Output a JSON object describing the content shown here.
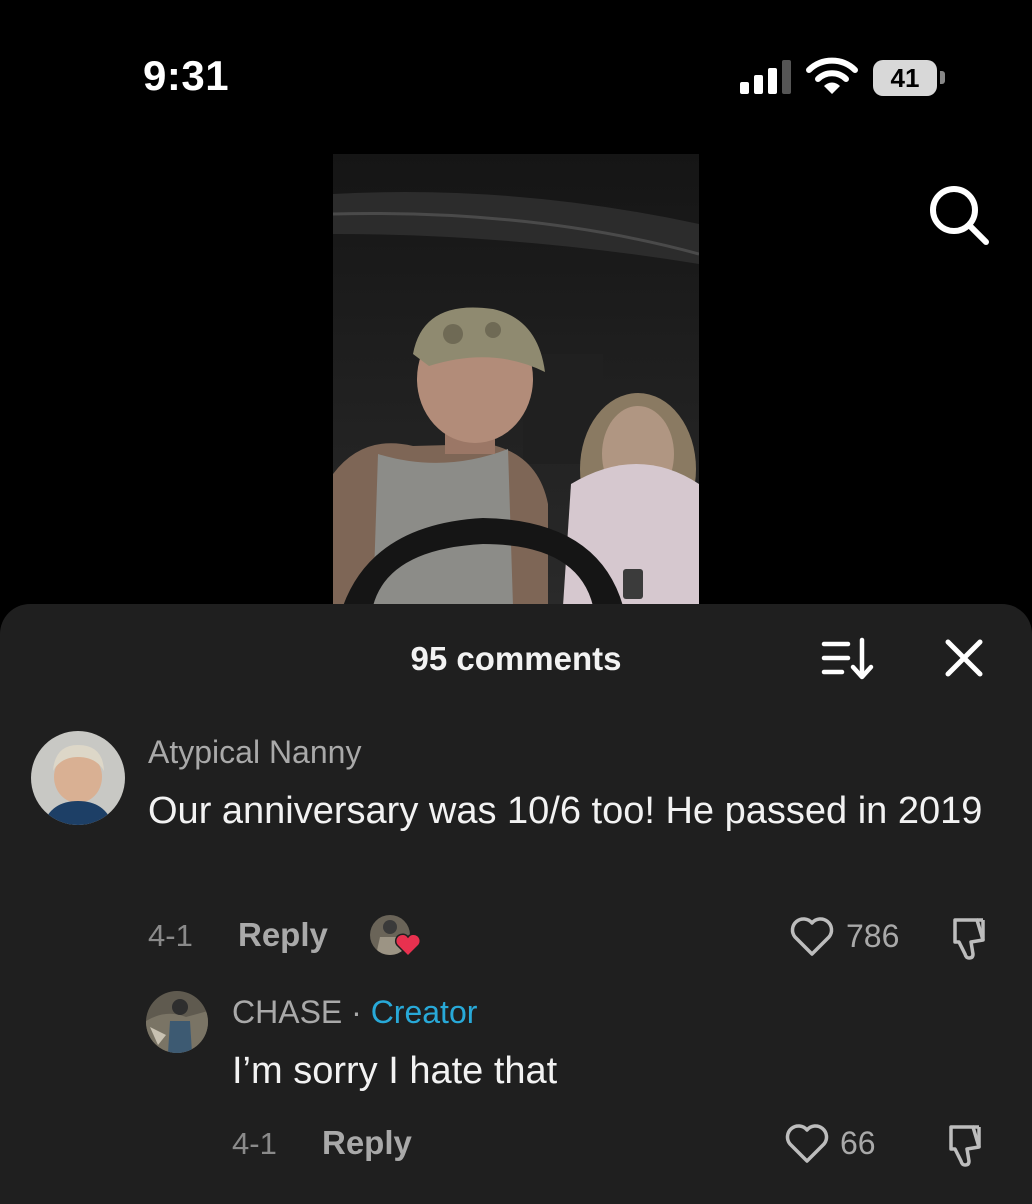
{
  "status_bar": {
    "time": "9:31",
    "battery": "41"
  },
  "video": {
    "icon": "search-icon"
  },
  "comments": {
    "title": "95 comments",
    "items": [
      {
        "author": "Atypical Nanny",
        "text": "Our anniversary was 10/6 too! He passed in 2019",
        "date": "4-1",
        "reply_label": "Reply",
        "likes": "786"
      },
      {
        "author": "CHASE",
        "separator": "·",
        "badge": "Creator",
        "text": "I’m sorry I hate that",
        "date": "4-1",
        "reply_label": "Reply",
        "likes": "66"
      }
    ]
  },
  "colors": {
    "sheet_bg": "#1f1f1f",
    "creator_badge": "#28a9d8",
    "liked_heart": "#e8314f"
  }
}
